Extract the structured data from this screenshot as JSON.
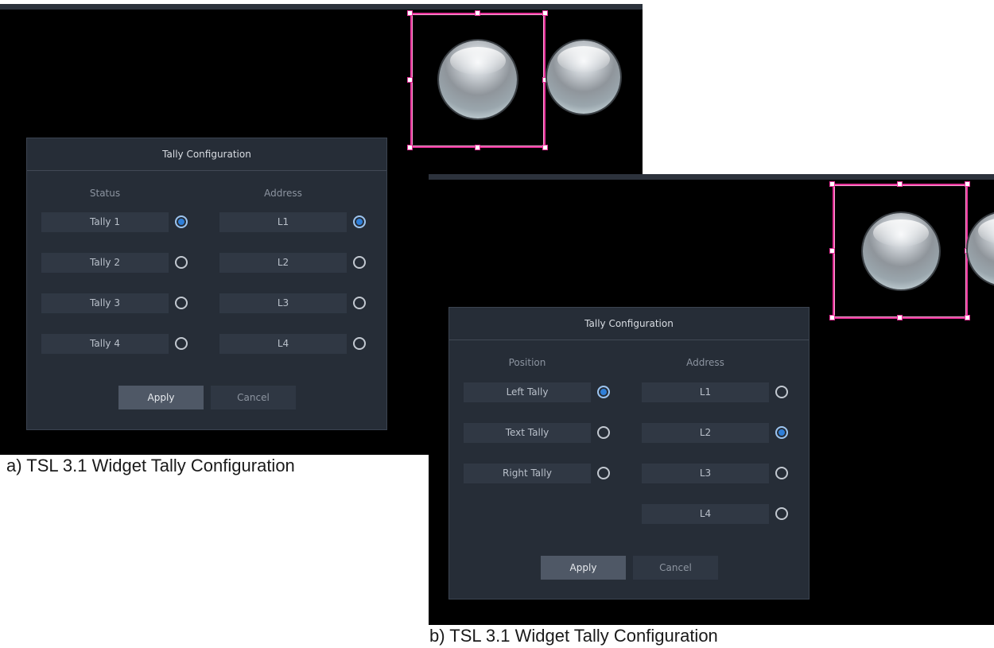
{
  "panel_a": {
    "dialog_title": "Tally Configuration",
    "left_header": "Status",
    "right_header": "Address",
    "left_items": [
      "Tally 1",
      "Tally 2",
      "Tally 3",
      "Tally 4"
    ],
    "right_items": [
      "L1",
      "L2",
      "L3",
      "L4"
    ],
    "left_selected": "Tally 1",
    "right_selected": "L1",
    "apply_label": "Apply",
    "cancel_label": "Cancel",
    "caption": "a) TSL 3.1 Widget Tally Configuration"
  },
  "panel_b": {
    "dialog_title": "Tally Configuration",
    "left_header": "Position",
    "right_header": "Address",
    "left_items": [
      "Left Tally",
      "Text Tally",
      "Right Tally"
    ],
    "right_items": [
      "L1",
      "L2",
      "L3",
      "L4"
    ],
    "left_selected": "Left Tally",
    "right_selected": "L2",
    "apply_label": "Apply",
    "cancel_label": "Cancel",
    "caption": "b) TSL 3.1 Widget Tally Configuration"
  },
  "colors": {
    "selection_border": "#e8329b",
    "radio_selected": "#2f7fd8",
    "dialog_bg": "#262d37"
  },
  "icons": [
    "tally-orb-icon",
    "radio-icon",
    "resize-handle-icon"
  ]
}
